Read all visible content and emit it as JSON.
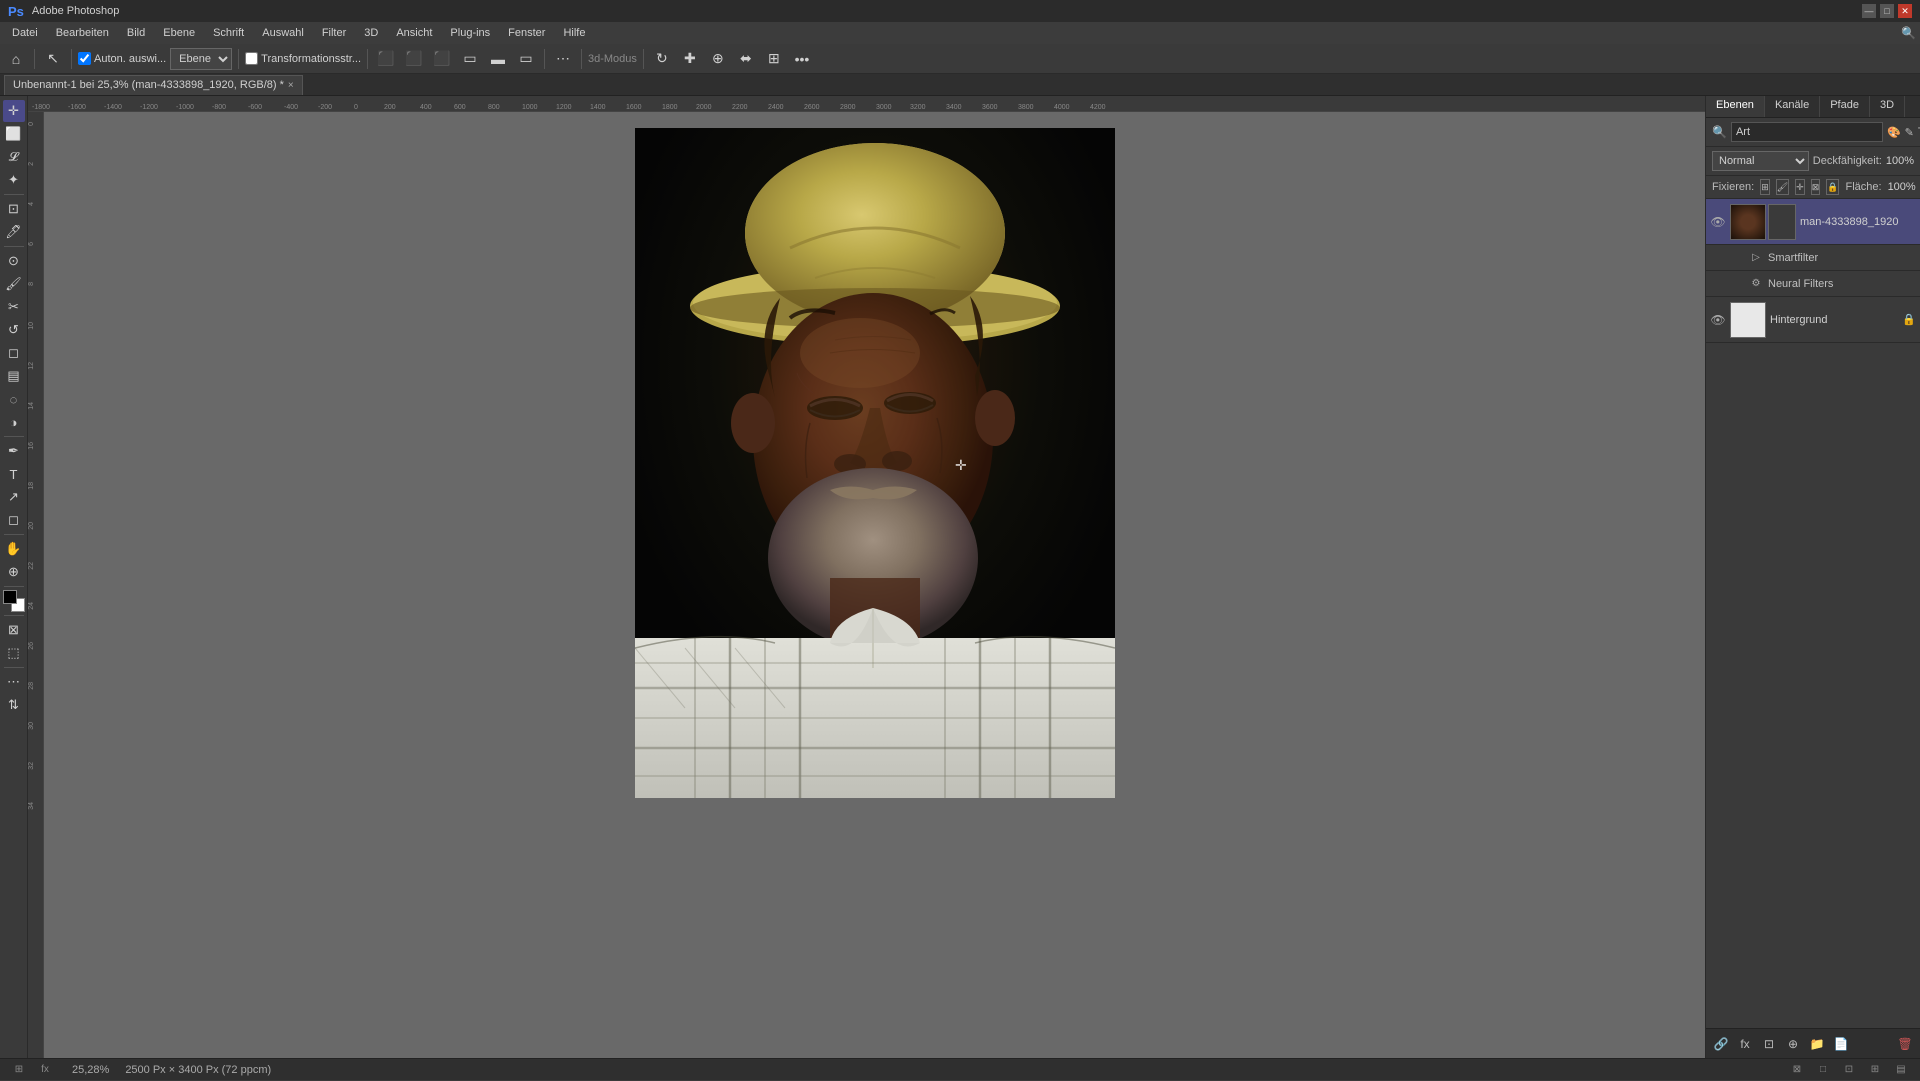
{
  "titleBar": {
    "appName": "Adobe Photoshop",
    "minimize": "—",
    "maximize": "□",
    "close": "✕"
  },
  "menuBar": {
    "items": [
      "Datei",
      "Bearbeiten",
      "Bild",
      "Ebene",
      "Schrift",
      "Auswahl",
      "Filter",
      "3D",
      "Ansicht",
      "Plug-ins",
      "Fenster",
      "Hilfe"
    ]
  },
  "toolbar": {
    "autoLabel": "Auton. auswi...",
    "layerLabel": "Ebene",
    "transformLabel": "Transformationsstr...",
    "checkboxLabel": "",
    "3dMode": "3d-Modus"
  },
  "tabBar": {
    "docTitle": "Unbenannt-1 bei 25,3% (man-4333898_1920, RGB/8) *",
    "close": "×"
  },
  "rightPanel": {
    "tabs": [
      "Ebenen",
      "Kanäle",
      "Pfade",
      "3D"
    ],
    "activeTab": "Ebenen",
    "searchPlaceholder": "Art",
    "blendMode": "Normal",
    "opacityLabel": "Deckfähigkeit:",
    "opacityValue": "100%",
    "fixierenLabel": "Fixieren:",
    "flächeLabel": "Fläche:",
    "flächeValue": "100%",
    "layers": [
      {
        "name": "man-4333898_1920",
        "visible": true,
        "selected": true,
        "locked": false,
        "type": "smart",
        "hasSubLayers": true,
        "subLayers": [
          "Smartfilter",
          "Neural Filters"
        ]
      },
      {
        "name": "Hintergrund",
        "visible": true,
        "selected": false,
        "locked": true,
        "type": "normal"
      }
    ]
  },
  "statusBar": {
    "zoom": "25,28%",
    "dimensions": "2500 Px × 3400 Px (72 ppcm)"
  },
  "canvas": {
    "rulerMarks": [
      "-1800",
      "-1600",
      "-1400",
      "-1200",
      "-1000",
      "-800",
      "-600",
      "-400",
      "-200",
      "0",
      "200",
      "400",
      "600",
      "800",
      "1000",
      "1200",
      "1400",
      "1600",
      "1800",
      "2000",
      "2200",
      "2400",
      "2600",
      "2800",
      "3000",
      "3200",
      "3400",
      "3600",
      "3800",
      "4000",
      "4200"
    ]
  }
}
